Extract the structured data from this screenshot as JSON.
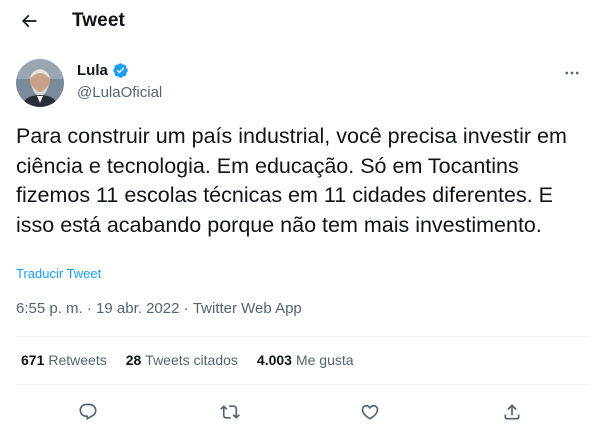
{
  "header": {
    "title": "Tweet",
    "back_icon": "arrow-left-icon"
  },
  "author": {
    "name": "Lula",
    "handle": "@LulaOficial",
    "verified_icon": "verified-badge-icon",
    "avatar": "avatar"
  },
  "tweet": {
    "text": "Para construir um país industrial, você precisa investir em ciência e tecnologia. Em educação. Só em Tocantins fizemos 11 escolas técnicas em 11 cidades diferentes. E isso está acabando porque não tem mais investimento.",
    "translate_label": "Traducir Tweet"
  },
  "meta": {
    "time": "6:55 p. m.",
    "sep1": " · ",
    "date": "19 abr. 2022",
    "sep2": " · ",
    "source": "Twitter Web App"
  },
  "stats": {
    "retweets_count": "671",
    "retweets_label": "Retweets",
    "quotes_count": "28",
    "quotes_label": "Tweets citados",
    "likes_count": "4.003",
    "likes_label": "Me gusta"
  },
  "actions": [
    "reply-icon",
    "retweet-icon",
    "like-icon",
    "share-icon"
  ],
  "colors": {
    "accent": "#1d9bf0",
    "text": "#0f1419",
    "muted": "#536471",
    "divider": "#eff3f4"
  }
}
